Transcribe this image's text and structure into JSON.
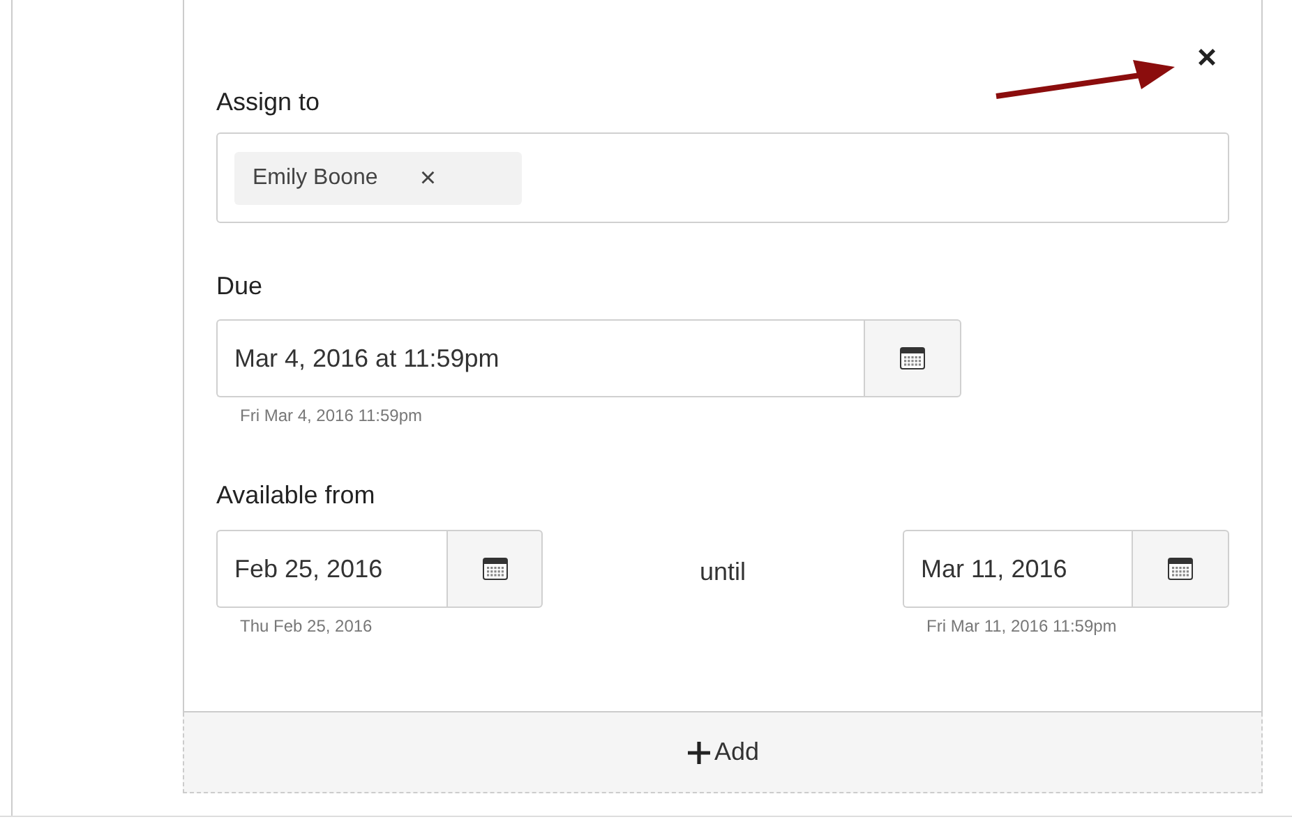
{
  "close_button": {
    "label": "×"
  },
  "assign": {
    "label": "Assign to",
    "chips": [
      {
        "name": "Emily Boone",
        "remove": "×"
      }
    ]
  },
  "due": {
    "label": "Due",
    "value": "Mar 4, 2016 at 11:59pm",
    "hint": "Fri Mar 4, 2016 11:59pm"
  },
  "available": {
    "label": "Available from",
    "from": {
      "value": "Feb 25, 2016",
      "hint": "Thu Feb 25, 2016"
    },
    "separator": "until",
    "until": {
      "value": "Mar 11, 2016",
      "hint": "Fri Mar 11, 2016 11:59pm"
    }
  },
  "add_button": {
    "label": "Add"
  }
}
